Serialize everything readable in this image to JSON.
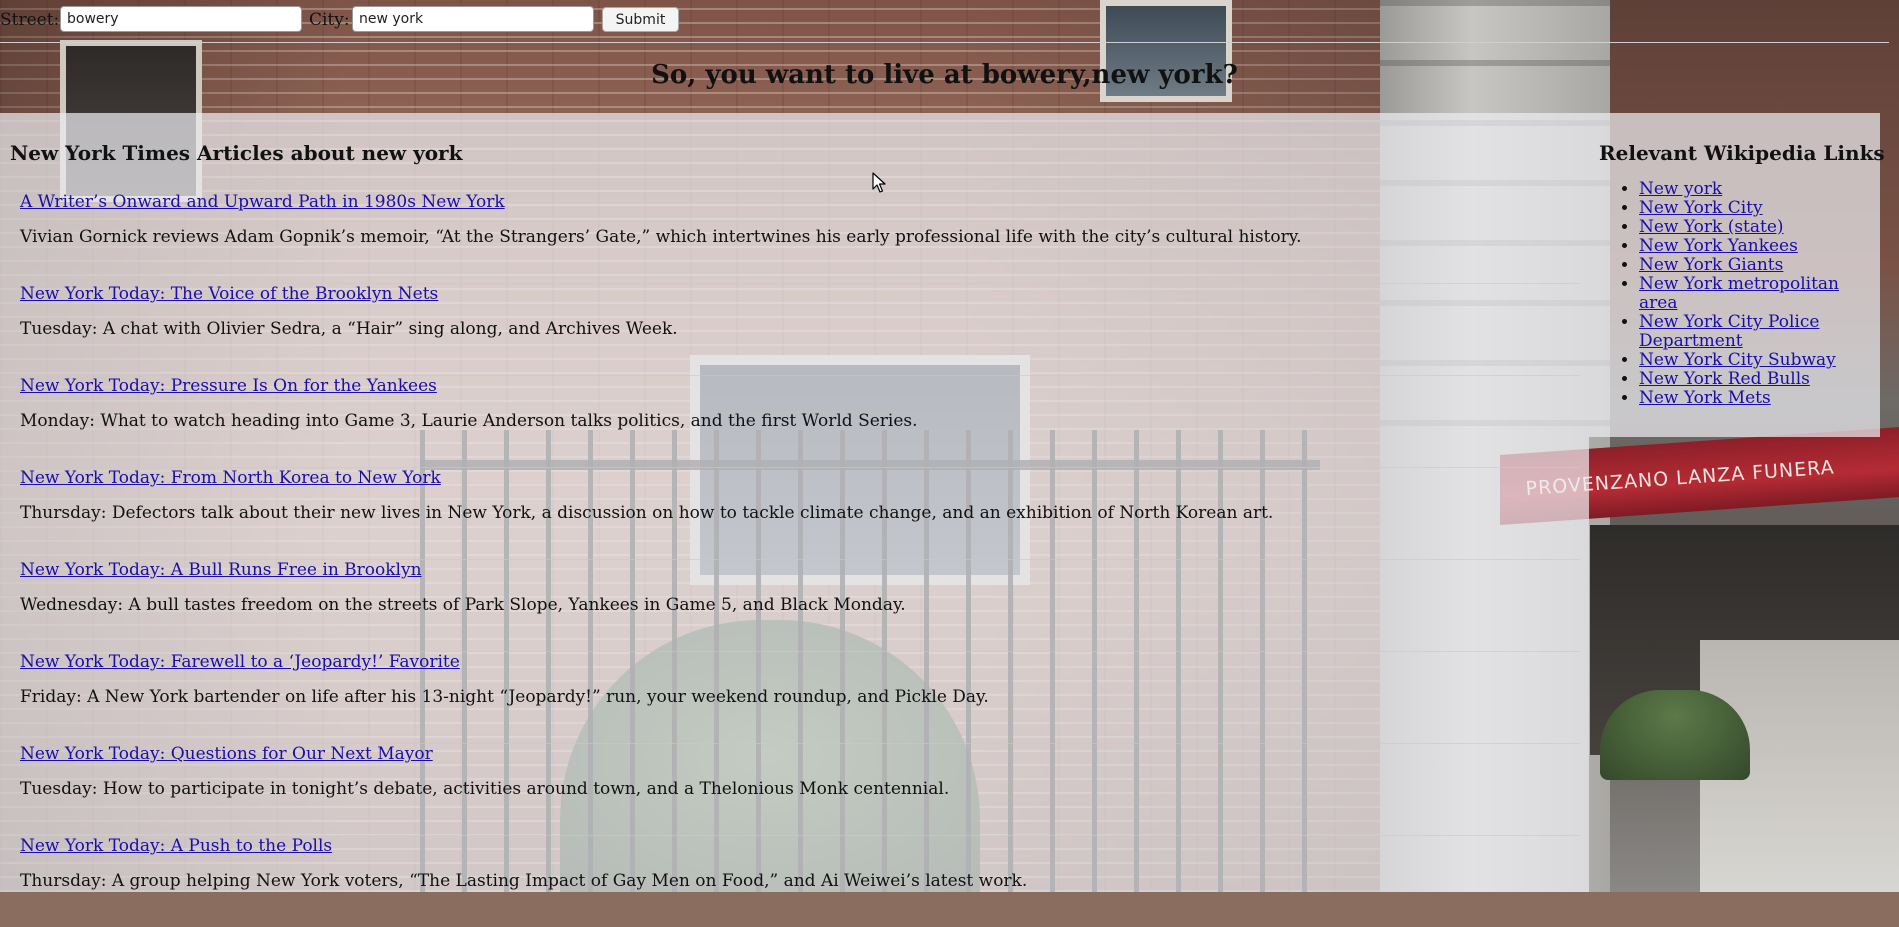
{
  "search": {
    "street_label": "Street:",
    "street_value": "bowery",
    "city_label": "City:",
    "city_value": "new york",
    "submit_label": "Submit"
  },
  "headline": "So, you want to live at bowery,new york?",
  "articles_section": {
    "title": "New York Times Articles about new york",
    "items": [
      {
        "headline": "A Writer’s Onward and Upward Path in 1980s New York",
        "summary": "Vivian Gornick reviews Adam Gopnik’s memoir, “At the Strangers’ Gate,” which intertwines his early professional life with the city’s cultural history."
      },
      {
        "headline": "New York Today: The Voice of the Brooklyn Nets",
        "summary": "Tuesday: A chat with Olivier Sedra, a “Hair” sing along, and Archives Week."
      },
      {
        "headline": "New York Today: Pressure Is On for the Yankees",
        "summary": "Monday: What to watch heading into Game 3, Laurie Anderson talks politics, and the first World Series."
      },
      {
        "headline": "New York Today: From North Korea to New York",
        "summary": "Thursday: Defectors talk about their new lives in New York, a discussion on how to tackle climate change, and an exhibition of North Korean art."
      },
      {
        "headline": "New York Today: A Bull Runs Free in Brooklyn",
        "summary": "Wednesday: A bull tastes freedom on the streets of Park Slope, Yankees in Game 5, and Black Monday."
      },
      {
        "headline": "New York Today: Farewell to a ‘Jeopardy!’ Favorite",
        "summary": "Friday: A New York bartender on life after his 13-night “Jeopardy!” run, your weekend roundup, and Pickle Day."
      },
      {
        "headline": "New York Today: Questions for Our Next Mayor",
        "summary": "Tuesday: How to participate in tonight’s debate, activities around town, and a Thelonious Monk centennial."
      },
      {
        "headline": "New York Today: A Push to the Polls",
        "summary": "Thursday: A group helping New York voters, “The Lasting Impact of Gay Men on Food,” and Ai Weiwei’s latest work."
      }
    ]
  },
  "wiki_section": {
    "title": "Relevant Wikipedia Links",
    "links": [
      "New york",
      "New York City",
      "New York (state)",
      "New York Yankees",
      "New York Giants",
      "New York metropolitan area",
      "New York City Police Department",
      "New York City Subway",
      "New York Red Bulls",
      "New York Mets"
    ]
  },
  "background": {
    "awning_text": "PROVENZANO LANZA FUNERA"
  },
  "colors": {
    "link": "#1a0dab",
    "panel_overlay": "rgba(236,236,240,0.72)",
    "awning": "#b52b35"
  },
  "icons": {
    "cursor": "mouse-pointer-icon"
  }
}
